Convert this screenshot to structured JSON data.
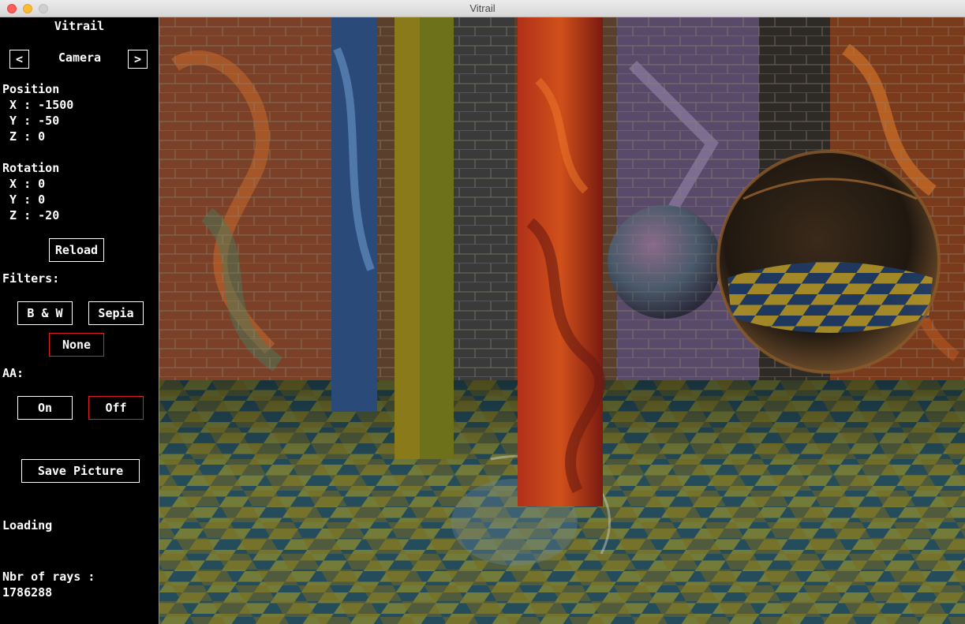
{
  "window": {
    "title": "Vitrail"
  },
  "sidebar": {
    "app_title": "Vitrail",
    "nav": {
      "prev_label": "<",
      "section_label": "Camera",
      "next_label": ">"
    },
    "position": {
      "heading": "Position",
      "x": " X : -1500",
      "y": " Y : -50",
      "z": " Z : 0"
    },
    "rotation": {
      "heading": "Rotation",
      "x": " X : 0",
      "y": " Y : 0",
      "z": " Z : -20"
    },
    "reload_label": "Reload",
    "filters": {
      "heading": "Filters:",
      "bw_label": "B & W",
      "sepia_label": "Sepia",
      "none_label": "None",
      "selected": "None"
    },
    "aa": {
      "heading": "AA:",
      "on_label": "On",
      "off_label": "Off",
      "selected": "Off"
    },
    "save_label": "Save Picture",
    "status": "Loading",
    "rays": {
      "label": "Nbr of rays :",
      "value": "1786288"
    }
  },
  "colors": {
    "selected_border": "#e02020",
    "panel_bg": "#000000",
    "text": "#ffffff"
  }
}
